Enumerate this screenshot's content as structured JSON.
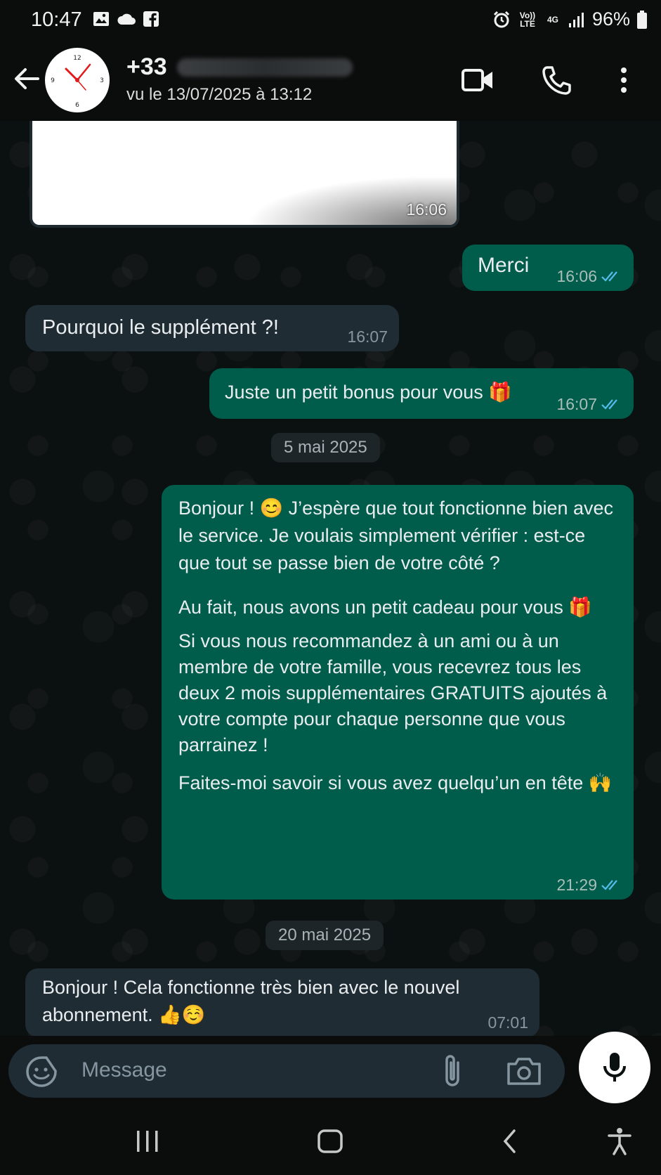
{
  "status_bar": {
    "time": "10:47",
    "battery": "96%",
    "volte": "Vo)) LTE",
    "network": "4G"
  },
  "header": {
    "contact_prefix": "+33",
    "last_seen": "vu le 13/07/2025 à 13:12"
  },
  "messages": [
    {
      "type": "image",
      "direction": "in",
      "time": "16:06"
    },
    {
      "type": "text",
      "direction": "out",
      "text": "Merci",
      "time": "16:06"
    },
    {
      "type": "text",
      "direction": "in",
      "text": "Pourquoi le supplément ?!",
      "time": "16:07"
    },
    {
      "type": "text",
      "direction": "out",
      "text": "Juste un petit bonus pour vous 🎁",
      "time": "16:07"
    },
    {
      "type": "date",
      "text": "5 mai 2025"
    },
    {
      "type": "text",
      "direction": "out",
      "paragraphs": [
        "Bonjour ! 😊 J’espère que tout fonctionne bien avec le service. Je voulais simplement vérifier : est-ce que tout se passe bien de votre côté ?",
        "Au fait, nous avons un petit cadeau pour vous 🎁",
        "Si vous nous recommandez à un ami ou à un membre de votre famille, vous recevrez tous les deux 2 mois supplémentaires GRATUITS ajoutés à votre compte pour chaque personne que vous parrainez !",
        "Faites-moi savoir si vous avez quelqu’un en tête 🙌"
      ],
      "time": "21:29"
    },
    {
      "type": "date",
      "text": "20 mai 2025"
    },
    {
      "type": "text",
      "direction": "in",
      "text": "Bonjour ! Cela fonctionne très bien avec le nouvel abonnement. 👍☺️",
      "time": "07:01"
    }
  ],
  "composer": {
    "placeholder": "Message"
  },
  "icons": {
    "back": "arrow-left-icon",
    "video": "video-call-icon",
    "call": "phone-icon",
    "menu": "more-vertical-icon",
    "emoji": "sticker-icon",
    "attach": "paperclip-icon",
    "camera": "camera-icon",
    "mic": "microphone-icon"
  },
  "colors": {
    "outgoing_bubble": "#005c4b",
    "incoming_bubble": "#202c33",
    "read_ticks": "#53bdeb",
    "background": "#0b1011"
  }
}
